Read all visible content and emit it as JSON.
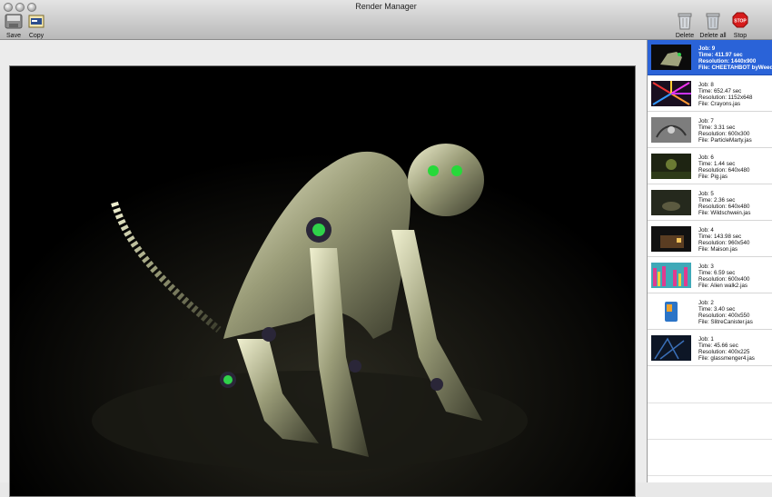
{
  "window": {
    "title": "Render Manager"
  },
  "toolbar": {
    "save_label": "Save",
    "copy_label": "Copy",
    "delete_label": "Delete",
    "delete_all_label": "Delete all",
    "stop_label": "Stop",
    "stop_icon_text": "STOP"
  },
  "jobs": [
    {
      "job": "Job: 9",
      "time": "Time: 411.97 sec",
      "resolution": "Resolution: 1440x900",
      "file": "File: CHEETAHBOT byWeedoM",
      "selected": true,
      "thumb": "cheetah-robot"
    },
    {
      "job": "Job: 8",
      "time": "Time: 652.47 sec",
      "resolution": "Resolution: 1152x648",
      "file": "File: Crayons.jas",
      "thumb": "crayons"
    },
    {
      "job": "Job: 7",
      "time": "Time: 3.31 sec",
      "resolution": "Resolution: 600x300",
      "file": "File: ParticleMarty.jas",
      "thumb": "particles"
    },
    {
      "job": "Job: 6",
      "time": "Time: 1.44 sec",
      "resolution": "Resolution: 640x480",
      "file": "File: Pig.jas",
      "thumb": "pig"
    },
    {
      "job": "Job: 5",
      "time": "Time: 2.36 sec",
      "resolution": "Resolution: 640x480",
      "file": "File: Wildschwein.jas",
      "thumb": "wildschwein"
    },
    {
      "job": "Job: 4",
      "time": "Time: 143.98 sec",
      "resolution": "Resolution: 960x540",
      "file": "File: Maison.jas",
      "thumb": "maison"
    },
    {
      "job": "Job: 3",
      "time": "Time: 6.59 sec",
      "resolution": "Resolution: 600x400",
      "file": "File: Alien walk2.jas",
      "thumb": "alien-walk"
    },
    {
      "job": "Job: 2",
      "time": "Time: 3.40 sec",
      "resolution": "Resolution: 400x550",
      "file": "File: SlitreCanister.jas",
      "thumb": "canister"
    },
    {
      "job": "Job: 1",
      "time": "Time: 45.66 sec",
      "resolution": "Resolution: 400x225",
      "file": "File: glassmenger4.jas",
      "thumb": "glass"
    }
  ],
  "preview": {
    "subject": "cheetah-robot-render"
  }
}
